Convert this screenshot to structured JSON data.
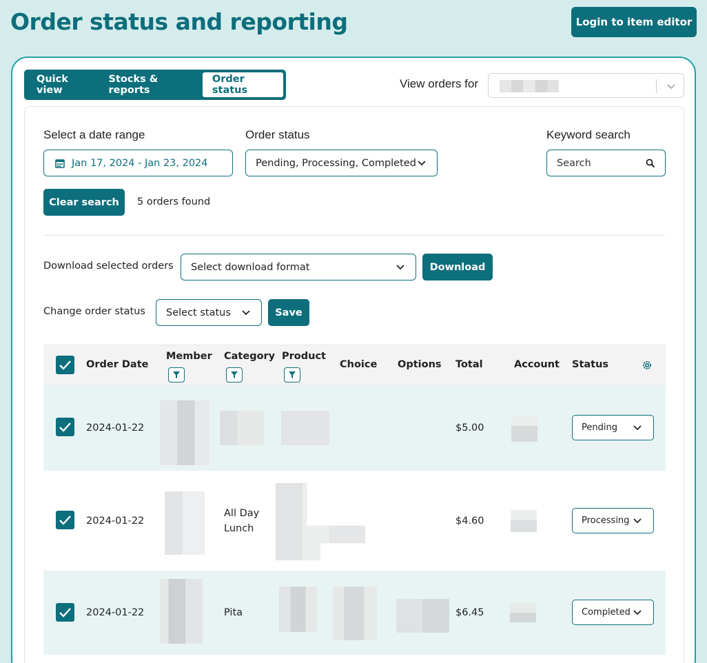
{
  "page": {
    "title": "Order status and reporting",
    "login_button": "Login to item editor"
  },
  "tabs": [
    {
      "label": "Quick view",
      "active": false
    },
    {
      "label": "Stocks & reports",
      "active": false
    },
    {
      "label": "Order status",
      "active": true
    }
  ],
  "view_orders": {
    "label": "View orders for"
  },
  "filters": {
    "date_label": "Select a date range",
    "date_value": "Jan 17, 2024 - Jan 23, 2024",
    "status_label": "Order status",
    "status_value": "Pending, Processing, Completed",
    "keyword_label": "Keyword search",
    "keyword_placeholder": "Search",
    "clear_button": "Clear search",
    "results_count": "5 orders found"
  },
  "download": {
    "label": "Download selected orders",
    "format_placeholder": "Select download format",
    "button": "Download"
  },
  "change_status": {
    "label": "Change order status",
    "placeholder": "Select status",
    "button": "Save"
  },
  "table": {
    "columns": [
      "Order Date",
      "Member",
      "Category",
      "Product",
      "Choice",
      "Options",
      "Total",
      "Account",
      "Status"
    ],
    "rows": [
      {
        "date": "2024-01-22",
        "category": "",
        "total": "$5.00",
        "status": "Pending",
        "checked": true
      },
      {
        "date": "2024-01-22",
        "category": "All Day Lunch",
        "total": "$4.60",
        "status": "Processing",
        "checked": true
      },
      {
        "date": "2024-01-22",
        "category": "Pita",
        "total": "$6.45",
        "status": "Completed",
        "checked": true
      }
    ]
  },
  "colors": {
    "brand": "#0d6e7c",
    "background": "#d5ecec",
    "accent_border": "#23a0a8"
  }
}
